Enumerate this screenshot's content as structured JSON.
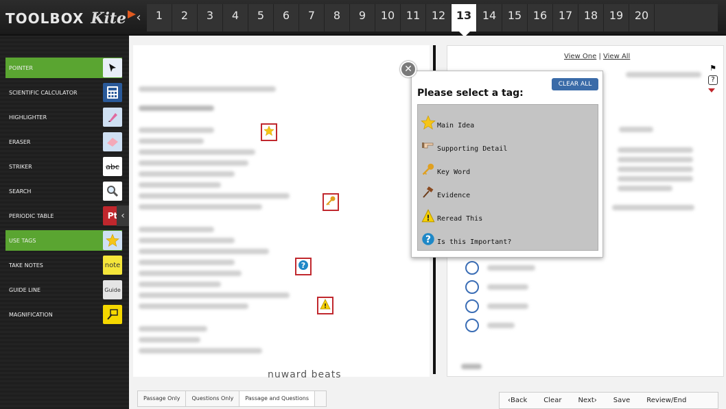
{
  "brand": {
    "toolbox": "TOOLBOX",
    "kite": "Kite"
  },
  "nav": {
    "prev_icon": "chevron-left",
    "questions": [
      "1",
      "2",
      "3",
      "4",
      "5",
      "6",
      "7",
      "8",
      "9",
      "10",
      "11",
      "12",
      "13",
      "14",
      "15",
      "16",
      "17",
      "18",
      "19",
      "20"
    ],
    "active": "13"
  },
  "sidebar": {
    "items": [
      {
        "label": "POINTER",
        "icon": "pointer-arrow",
        "active": true
      },
      {
        "label": "SCIENTIFIC CALCULATOR",
        "icon": "calculator",
        "active": false
      },
      {
        "label": "HIGHLIGHTER",
        "icon": "highlighter",
        "active": false
      },
      {
        "label": "ERASER",
        "icon": "eraser",
        "active": false
      },
      {
        "label": "STRIKER",
        "icon": "striker",
        "icon_text": "abc",
        "active": false
      },
      {
        "label": "SEARCH",
        "icon": "magnifier",
        "active": false
      },
      {
        "label": "PERIODIC TABLE",
        "icon": "periodic-table",
        "icon_text": "Pt",
        "active": false
      },
      {
        "label": "USE TAGS",
        "icon": "star",
        "active": true
      },
      {
        "label": "TAKE NOTES",
        "icon": "note",
        "icon_text": "note",
        "active": false
      },
      {
        "label": "GUIDE LINE",
        "icon": "guide",
        "icon_text": "Guide",
        "active": false
      },
      {
        "label": "MAGNIFICATION",
        "icon": "magnification",
        "active": false
      }
    ],
    "collapse_icon": "chevron-left"
  },
  "passage": {
    "visible_fragment": "nuward beats"
  },
  "question_pane": {
    "view_one": "View One",
    "separator": "|",
    "view_all": "View All"
  },
  "tag_popup": {
    "title": "Please select a tag:",
    "clear_all": "CLEAR ALL",
    "close_icon": "close-x",
    "tags": [
      {
        "label": "Main Idea",
        "icon": "star"
      },
      {
        "label": "Supporting Detail",
        "icon": "pointing-hand"
      },
      {
        "label": "Key Word",
        "icon": "key"
      },
      {
        "label": "Evidence",
        "icon": "gavel"
      },
      {
        "label": "Reread This",
        "icon": "warning"
      },
      {
        "label": "Is this Important?",
        "icon": "question"
      }
    ]
  },
  "passage_tags": [
    "star",
    "key",
    "question",
    "warning"
  ],
  "bottom_left": {
    "tabs": [
      "Passage Only",
      "Questions Only",
      "Passage and Questions"
    ],
    "active": "Passage and Questions"
  },
  "bottom_right": {
    "back": "‹Back",
    "clear": "Clear",
    "next": "Next›",
    "save": "Save",
    "review": "Review/End"
  },
  "colors": {
    "accent_green": "#5aa531",
    "marker_red": "#c0272d",
    "button_blue": "#3a6ba8"
  }
}
